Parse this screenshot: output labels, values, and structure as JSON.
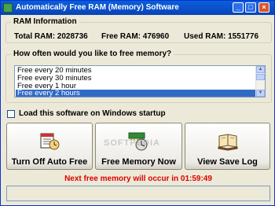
{
  "window": {
    "title": "Automatically Free RAM (Memory) Software"
  },
  "ram_info": {
    "legend": "RAM Information",
    "total": "Total RAM: 2028736",
    "free": "Free RAM: 476960",
    "used": "Used RAM: 1551776"
  },
  "frequency": {
    "legend": "How often would you like to free memory?",
    "options": [
      "Free every 20 minutes",
      "Free every 30 minutes",
      "Free every 1 hour",
      "Free every 2 hours"
    ],
    "selected": "Free every 2 hours"
  },
  "startup": {
    "label": "Load this software on Windows startup",
    "checked": false
  },
  "buttons": {
    "auto_free": "Turn Off Auto Free",
    "free_memory": "Free Memory Now",
    "view_log": "View Save Log"
  },
  "watermark": "SOFTPEDIA",
  "status": {
    "next_free": "Next free memory will occur in 01:59:49"
  },
  "colors": {
    "title_bar": "#0b4fc9",
    "selection": "#316ac5",
    "next_free_text": "#e00000"
  }
}
